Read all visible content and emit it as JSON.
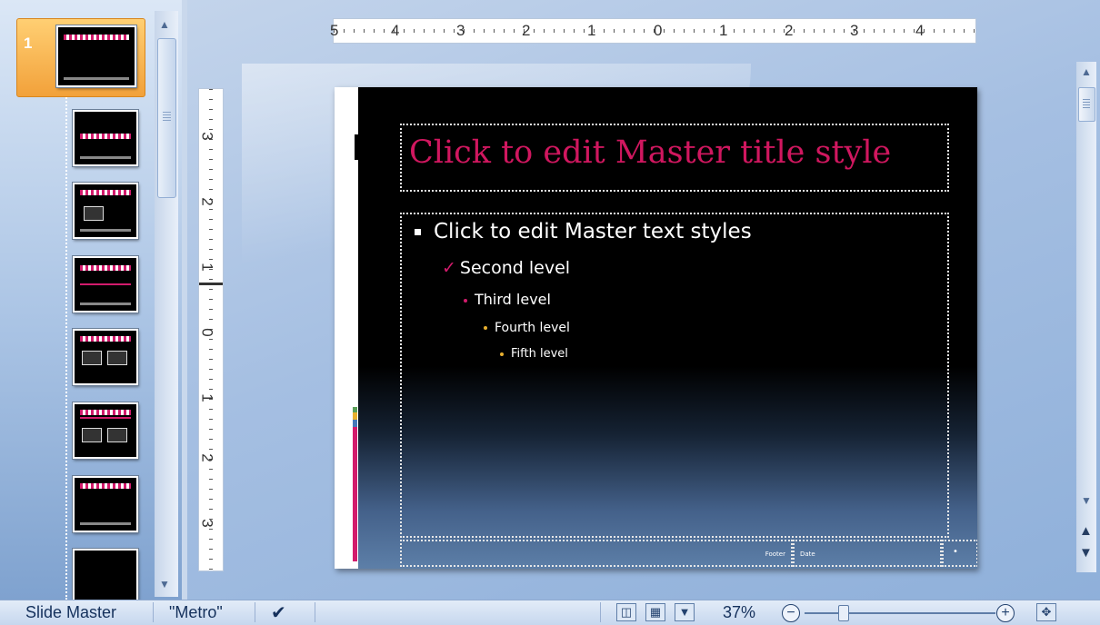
{
  "thumbnails": {
    "selected_number": "1"
  },
  "ruler": {
    "horizontal": [
      "5",
      "4",
      "3",
      "2",
      "1",
      "0",
      "1",
      "2",
      "3",
      "4"
    ],
    "vertical": [
      "3",
      "2",
      "1",
      "0",
      "1",
      "2",
      "3"
    ]
  },
  "slide": {
    "title": "Click to edit Master title style",
    "level1": "Click to edit Master text styles",
    "level2": "Second level",
    "level3": "Third level",
    "level4": "Fourth level",
    "level5": "Fifth level",
    "footer": "Footer",
    "date": "Date",
    "number_icon": "•",
    "title_color": "#d0175f",
    "accent_color": "#d21b6c"
  },
  "status": {
    "view_name": "Slide Master",
    "theme_name": "\"Metro\"",
    "zoom": "37%",
    "zoom_minus": "−",
    "zoom_plus": "+"
  },
  "icons": {
    "spell_check": "spell-check-icon",
    "normal_view": "normal-view-icon",
    "sorter_view": "slide-sorter-view-icon",
    "show_view": "slide-show-icon",
    "fit": "fit-to-window-icon"
  }
}
